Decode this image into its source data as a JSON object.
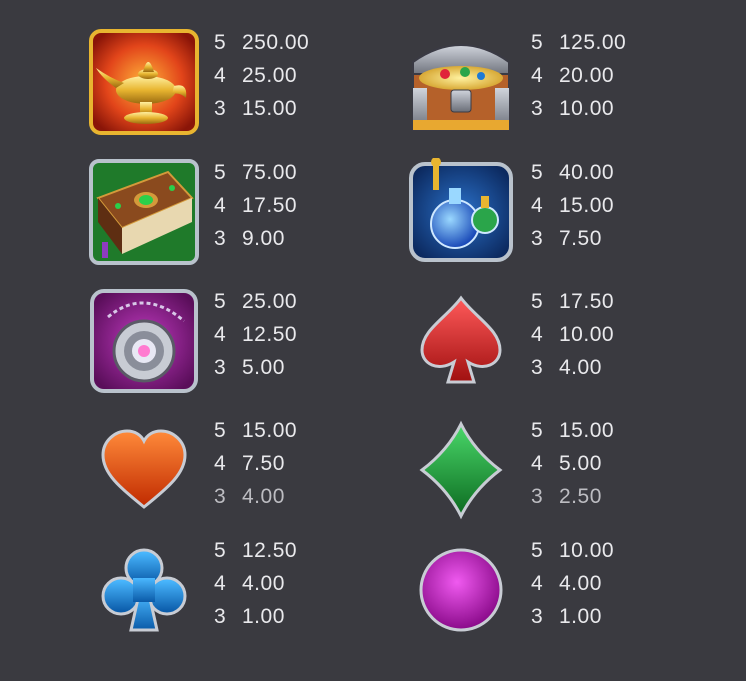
{
  "paytable": {
    "rows": [
      {
        "left": {
          "symbol": "magic-lamp",
          "icon": "lamp-icon",
          "pays": [
            {
              "count": "5",
              "value": "250.00"
            },
            {
              "count": "4",
              "value": "25.00"
            },
            {
              "count": "3",
              "value": "15.00"
            }
          ]
        },
        "right": {
          "symbol": "treasure-chest",
          "icon": "chest-icon",
          "pays": [
            {
              "count": "5",
              "value": "125.00"
            },
            {
              "count": "4",
              "value": "20.00"
            },
            {
              "count": "3",
              "value": "10.00"
            }
          ]
        }
      },
      {
        "left": {
          "symbol": "spell-book",
          "icon": "book-icon",
          "pays": [
            {
              "count": "5",
              "value": "75.00"
            },
            {
              "count": "4",
              "value": "17.50"
            },
            {
              "count": "3",
              "value": "9.00"
            }
          ]
        },
        "right": {
          "symbol": "potions",
          "icon": "potion-icon",
          "pays": [
            {
              "count": "5",
              "value": "40.00"
            },
            {
              "count": "4",
              "value": "15.00"
            },
            {
              "count": "3",
              "value": "7.50"
            }
          ]
        }
      },
      {
        "left": {
          "symbol": "amulet",
          "icon": "amulet-icon",
          "pays": [
            {
              "count": "5",
              "value": "25.00"
            },
            {
              "count": "4",
              "value": "12.50"
            },
            {
              "count": "3",
              "value": "5.00"
            }
          ]
        },
        "right": {
          "symbol": "spade",
          "icon": "spade-icon",
          "pays": [
            {
              "count": "5",
              "value": "17.50"
            },
            {
              "count": "4",
              "value": "10.00"
            },
            {
              "count": "3",
              "value": "4.00"
            }
          ]
        }
      },
      {
        "left": {
          "symbol": "heart",
          "icon": "heart-icon",
          "pays": [
            {
              "count": "5",
              "value": "15.00"
            },
            {
              "count": "4",
              "value": "7.50"
            },
            {
              "count": "3",
              "value": "4.00"
            }
          ]
        },
        "right": {
          "symbol": "diamond",
          "icon": "diamond-icon",
          "pays": [
            {
              "count": "5",
              "value": "15.00"
            },
            {
              "count": "4",
              "value": "5.00"
            },
            {
              "count": "3",
              "value": "2.50"
            }
          ]
        }
      },
      {
        "left": {
          "symbol": "club",
          "icon": "club-icon",
          "pays": [
            {
              "count": "5",
              "value": "12.50"
            },
            {
              "count": "4",
              "value": "4.00"
            },
            {
              "count": "3",
              "value": "1.00"
            }
          ]
        },
        "right": {
          "symbol": "circle",
          "icon": "circle-icon",
          "pays": [
            {
              "count": "5",
              "value": "10.00"
            },
            {
              "count": "4",
              "value": "4.00"
            },
            {
              "count": "3",
              "value": "1.00"
            }
          ]
        }
      }
    ]
  },
  "colors": {
    "background": "#3a3a40",
    "text": "#e9e9ec",
    "spade": "#d42a2a",
    "heart": "#f05a10",
    "diamond": "#1f9a3a",
    "club": "#1e8fd6",
    "circle": "#c025c0"
  }
}
